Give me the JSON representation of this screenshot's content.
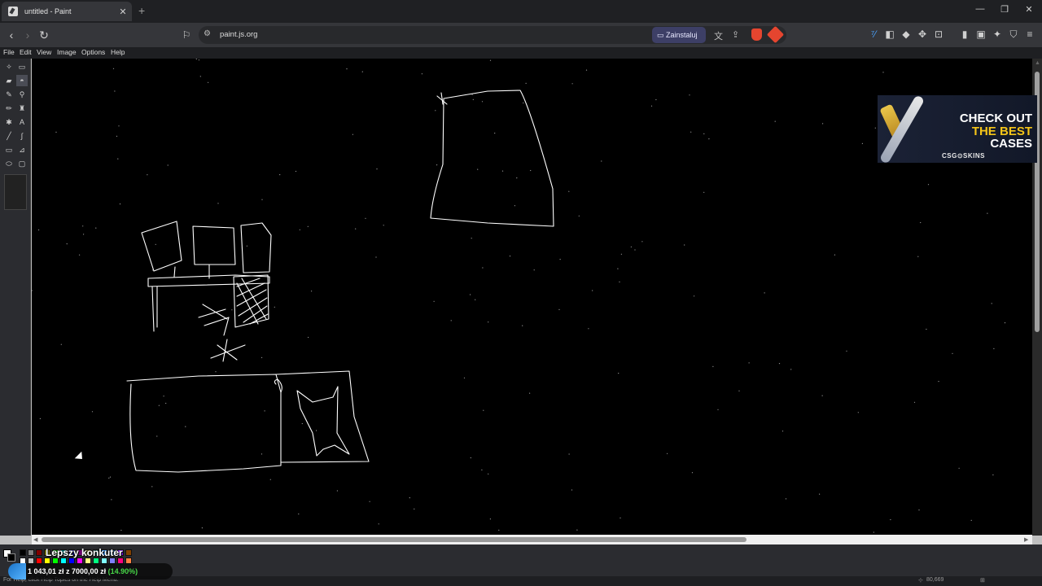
{
  "browser": {
    "tab_title": "untitled - Paint",
    "tab_close": "✕",
    "new_tab": "+",
    "url": "paint.js.org",
    "install_label": "Zainstaluj",
    "window_controls": [
      "—",
      "❐",
      "✕"
    ]
  },
  "menu": {
    "items": [
      "File",
      "Edit",
      "View",
      "Image",
      "Options",
      "Help"
    ]
  },
  "tools": [
    {
      "icon": "free-form-select-icon",
      "glyph": "✧"
    },
    {
      "icon": "rect-select-icon",
      "glyph": "▭"
    },
    {
      "icon": "eraser-icon",
      "glyph": "▰"
    },
    {
      "icon": "fill-bucket-icon",
      "glyph": "◓"
    },
    {
      "icon": "color-picker-icon",
      "glyph": "✎"
    },
    {
      "icon": "magnifier-icon",
      "glyph": "⚲"
    },
    {
      "icon": "pencil-icon",
      "glyph": "✏"
    },
    {
      "icon": "brush-icon",
      "glyph": "♜"
    },
    {
      "icon": "airbrush-icon",
      "glyph": "✱"
    },
    {
      "icon": "text-icon",
      "glyph": "A"
    },
    {
      "icon": "line-icon",
      "glyph": "╱"
    },
    {
      "icon": "curve-icon",
      "glyph": "∫"
    },
    {
      "icon": "rectangle-icon",
      "glyph": "▭"
    },
    {
      "icon": "polygon-icon",
      "glyph": "⊿"
    },
    {
      "icon": "ellipse-icon",
      "glyph": "⬭"
    },
    {
      "icon": "rounded-rect-icon",
      "glyph": "▢"
    }
  ],
  "status": {
    "coords": "80,669",
    "help_text": "For Help, click Help Topics on the Help Menu."
  },
  "overlay": {
    "title": "Lepszy konkuter",
    "amount": "1 043,01 zł z 7000,00 zł",
    "percent": "(14.90%)"
  },
  "ad": {
    "line1": "CHECK OUT",
    "line2": "THE BEST",
    "line3": "CASES",
    "brand": "CSG⊙SKINS"
  },
  "palette": [
    "#000000",
    "#808080",
    "#800000",
    "#808000",
    "#008000",
    "#008080",
    "#000080",
    "#800080",
    "#808040",
    "#004040",
    "#0080ff",
    "#004080",
    "#8000ff",
    "#804000",
    "#ffffff",
    "#c0c0c0",
    "#ff0000",
    "#ffff00",
    "#00ff00",
    "#00ffff",
    "#0000ff",
    "#ff00ff",
    "#ffff80",
    "#00ff80",
    "#80ffff",
    "#8080ff",
    "#ff0080",
    "#ff8040"
  ]
}
